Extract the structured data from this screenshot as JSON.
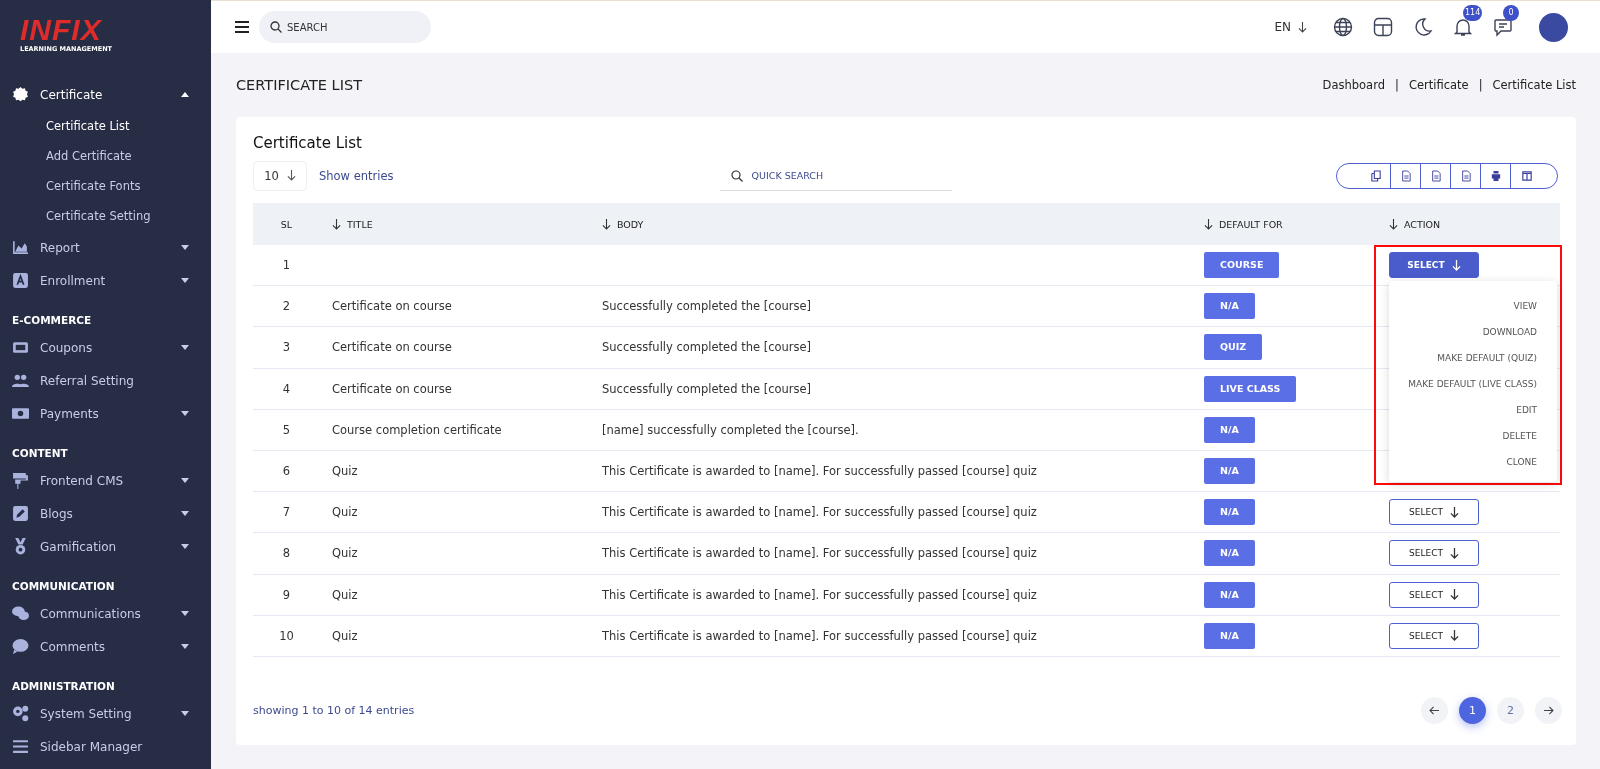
{
  "sidebar": {
    "logo": {
      "word": "INFIX",
      "tagline": "LEARNING MANAGEMENT"
    },
    "sections": [
      {
        "items": [
          {
            "label": "Certificate",
            "has_submenu": true,
            "expanded": true,
            "children": [
              {
                "label": "Certificate List",
                "selected": true
              },
              {
                "label": "Add Certificate",
                "selected": false
              },
              {
                "label": "Certificate Fonts",
                "selected": false
              },
              {
                "label": "Certificate Setting",
                "selected": false
              }
            ]
          },
          {
            "label": "Report",
            "has_submenu": true,
            "expanded": false
          },
          {
            "label": "Enrollment",
            "has_submenu": true,
            "expanded": false
          }
        ]
      },
      {
        "heading": "E-COMMERCE",
        "items": [
          {
            "label": "Coupons",
            "has_submenu": true,
            "expanded": false
          },
          {
            "label": "Referral Setting",
            "has_submenu": false,
            "expanded": false
          },
          {
            "label": "Payments",
            "has_submenu": true,
            "expanded": false
          }
        ]
      },
      {
        "heading": "CONTENT",
        "items": [
          {
            "label": "Frontend CMS",
            "has_submenu": true,
            "expanded": false
          },
          {
            "label": "Blogs",
            "has_submenu": true,
            "expanded": false
          },
          {
            "label": "Gamification",
            "has_submenu": true,
            "expanded": false
          }
        ]
      },
      {
        "heading": "COMMUNICATION",
        "items": [
          {
            "label": "Communications",
            "has_submenu": true,
            "expanded": false
          },
          {
            "label": "Comments",
            "has_submenu": true,
            "expanded": false
          }
        ]
      },
      {
        "heading": "ADMINISTRATION",
        "items": [
          {
            "label": "System Setting",
            "has_submenu": true,
            "expanded": false
          },
          {
            "label": "Sidebar Manager",
            "has_submenu": false,
            "expanded": false
          }
        ]
      }
    ]
  },
  "topbar": {
    "search": {
      "placeholder": "SEARCH"
    },
    "language": "EN",
    "notifications": "114",
    "messages": "0"
  },
  "page_title": "CERTIFICATE LIST",
  "breadcrumb": {
    "separator": "|",
    "items": [
      "Dashboard",
      "Certificate",
      "Certificate List"
    ]
  },
  "card": {
    "title": "Certificate List",
    "page_size": "10",
    "page_size_label": "Show entries",
    "quick_search": {
      "placeholder": "QUICK SEARCH"
    },
    "table": {
      "columns": [
        {
          "label": "SL",
          "sortable": false
        },
        {
          "label": "TITLE",
          "sortable": true
        },
        {
          "label": "BODY",
          "sortable": true
        },
        {
          "label": "DEFAULT FOR",
          "sortable": true
        },
        {
          "label": "ACTION",
          "sortable": true
        }
      ],
      "rows": [
        {
          "sl": "1",
          "default_for": "COURSE",
          "action": {
            "label": "SELECT",
            "open": true
          }
        },
        {
          "sl": "2",
          "title": "Certificate on course",
          "body": "Successfully completed the [course]",
          "default_for": "N/A"
        },
        {
          "sl": "3",
          "title": "Certificate on course",
          "body": "Successfully completed the [course]",
          "default_for": "QUIZ"
        },
        {
          "sl": "4",
          "title": "Certificate on course",
          "body": "Successfully completed the [course]",
          "default_for": "LIVE CLASS"
        },
        {
          "sl": "5",
          "title": "Course completion certificate",
          "body": "[name] successfully completed the [course].",
          "default_for": "N/A"
        },
        {
          "sl": "6",
          "title": "Quiz",
          "body": "This Certificate is awarded to [name]. For successfully passed [course] quiz",
          "default_for": "N/A"
        },
        {
          "sl": "7",
          "title": "Quiz",
          "body": "This Certificate is awarded to [name]. For successfully passed [course] quiz",
          "default_for": "N/A",
          "action": {
            "label": "SELECT",
            "open": false
          }
        },
        {
          "sl": "8",
          "title": "Quiz",
          "body": "This Certificate is awarded to [name]. For successfully passed [course] quiz",
          "default_for": "N/A",
          "action": {
            "label": "SELECT",
            "open": false
          }
        },
        {
          "sl": "9",
          "title": "Quiz",
          "body": "This Certificate is awarded to [name]. For successfully passed [course] quiz",
          "default_for": "N/A",
          "action": {
            "label": "SELECT",
            "open": false
          }
        },
        {
          "sl": "10",
          "title": "Quiz",
          "body": "This Certificate is awarded to [name]. For successfully passed [course] quiz",
          "default_for": "N/A",
          "action": {
            "label": "SELECT",
            "open": false
          }
        }
      ]
    },
    "action_menu": [
      "VIEW",
      "DOWNLOAD",
      "MAKE DEFAULT (QUIZ)",
      "MAKE DEFAULT (LIVE CLASS)",
      "EDIT",
      "DELETE",
      "CLONE"
    ],
    "footer": "showing 1 to 10 of 14 entries",
    "pages": [
      {
        "label": "1",
        "selected": true
      },
      {
        "label": "2",
        "selected": false
      }
    ]
  }
}
